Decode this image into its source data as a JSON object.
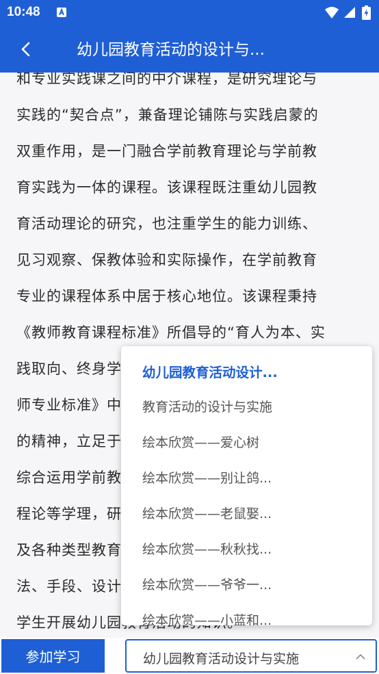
{
  "status": {
    "time": "10:48",
    "icons": [
      "app-notification-icon",
      "wifi-icon",
      "signal-icon",
      "battery-charging-icon"
    ]
  },
  "appbar": {
    "title": "幼儿园教育活动的设计与..."
  },
  "body_lines": [
    "和专业实践课之间的中介课程，是研究理论与",
    "实践的“契合点”，兼备理论铺陈与实践启蒙的",
    "双重作用，是一门融合学前教育理论与学前教",
    "育实践为一体的课程。该课程既注重幼儿园教",
    "育活动理论的研究，也注重学生的能力训练、",
    "见习观察、保教体验和实际操作，在学前教育",
    "专业的课程体系中居于核心地位。该课程秉持",
    "《教师教育课程标准》所倡导的“育人为本、实",
    "践取向、终身学",
    "师专业标准》中",
    "的精神，立足于",
    "综合运用学前教",
    "程论等学理，研",
    "及各种类型教育",
    "法、手段、设计",
    "学生开展幼儿园教育活动的知识。"
  ],
  "dropdown": {
    "options": [
      "幼儿园教育活动设计...",
      "教育活动的设计与实施",
      "绘本欣赏——爱心树",
      "绘本欣赏——别让鸽...",
      "绘本欣赏——老鼠娶...",
      "绘本欣赏——秋秋找...",
      "绘本欣赏——爷爷一...",
      "绘本欣赏——小蓝和..."
    ],
    "selected_index": 0
  },
  "bottom": {
    "join_label": "参加学习",
    "select_value": "幼儿园教育活动设计与实施"
  },
  "colors": {
    "primary": "#1f5fd6",
    "background": "#f6f6f8"
  }
}
